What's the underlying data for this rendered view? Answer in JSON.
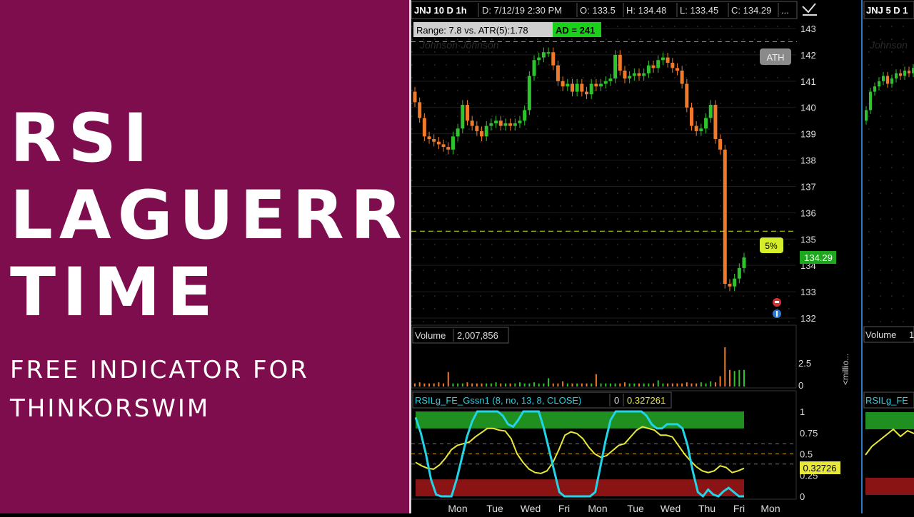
{
  "banner": {
    "title_lines": [
      "RSI",
      "LAGUERRE",
      "TIME"
    ],
    "subtitle_lines": [
      "FREE INDICATOR FOR",
      "THINKORSWIM"
    ]
  },
  "chart_main": {
    "symbol_label": "JNJ 10 D 1h",
    "date_label": "D: 7/12/19 2:30 PM",
    "open_label": "O: 133.5",
    "high_label": "H: 134.48",
    "low_label": "L: 133.45",
    "close_label": "C: 134.29",
    "more_label": "...",
    "range_label": "Range: 7.8 vs. ATR(5):1.78",
    "ad_label": "AD = 241",
    "ath_label": "ATH",
    "pct_label": "5%",
    "last_price_label": "134.29",
    "logo_text": "Johnson·Johnson"
  },
  "chart_side": {
    "symbol_label": "JNJ 5 D 1",
    "logo_text": "Johnson",
    "volume_label": "Volume",
    "volume_value": "1",
    "rsi_label": "RSILg_FE"
  },
  "volume": {
    "label": "Volume",
    "value": "2,007,856",
    "axis_tick": "2.5",
    "axis_zero": "0",
    "unit_label": "<millio..."
  },
  "rsi": {
    "label": "RSILg_FE_Gssn1 (8, no, 13, 8, CLOSE)",
    "flag": "0",
    "value": "0.327261",
    "last_value_label": "0.32726"
  },
  "x_axis": {
    "labels": [
      "Mon",
      "Tue",
      "Wed",
      "Fri",
      "Mon",
      "Tue",
      "Wed",
      "Thu",
      "Fri",
      "Mon"
    ]
  },
  "colors": {
    "banner_bg": "#7e0d4e",
    "up_candle": "#2ec42e",
    "down_candle": "#f07a2a",
    "rsi_line": "#22d4e8",
    "signal_line": "#e8e83a",
    "overbought_zone": "#1f8f1f",
    "oversold_zone": "#8a1414"
  },
  "chart_data": [
    {
      "type": "candlestick",
      "title": "JNJ 10 D 1h",
      "ylim": [
        132,
        143
      ],
      "y_ticks": [
        132,
        133,
        134,
        135,
        136,
        137,
        138,
        139,
        140,
        141,
        142,
        143
      ],
      "grid": true,
      "closes": [
        140.2,
        139.6,
        138.9,
        138.8,
        138.7,
        138.6,
        138.5,
        138.4,
        138.9,
        139.2,
        140.1,
        139.5,
        139.3,
        139.1,
        138.9,
        139.3,
        139.4,
        139.5,
        139.3,
        139.4,
        139.3,
        139.4,
        139.5,
        139.9,
        141.2,
        141.8,
        141.9,
        142.1,
        142.1,
        141.6,
        141.0,
        140.8,
        140.9,
        140.6,
        140.9,
        140.6,
        140.5,
        140.9,
        140.8,
        140.9,
        141.0,
        141.1,
        142.0,
        141.4,
        141.1,
        141.2,
        141.3,
        141.2,
        141.3,
        141.6,
        141.5,
        141.8,
        141.9,
        141.7,
        141.5,
        141.4,
        140.9,
        140.0,
        139.3,
        139.1,
        139.2,
        139.6,
        140.1,
        138.8,
        138.4,
        133.3,
        133.2,
        133.5,
        133.9,
        134.3
      ],
      "ath": 142.5,
      "level_5pct": 135.3,
      "last_price": 134.29
    },
    {
      "type": "bar",
      "title": "Volume",
      "unit": "millions",
      "ylim": [
        0,
        4
      ],
      "y_ticks": [
        0,
        2.5
      ],
      "values": [
        0.3,
        0.4,
        0.3,
        0.3,
        0.3,
        0.4,
        0.3,
        1.4,
        0.3,
        0.3,
        0.3,
        0.4,
        0.3,
        0.3,
        0.3,
        0.3,
        0.3,
        0.4,
        0.3,
        0.3,
        0.3,
        0.3,
        0.4,
        0.3,
        0.3,
        0.4,
        0.3,
        0.3,
        0.8,
        0.3,
        0.3,
        0.5,
        0.3,
        0.3,
        0.3,
        0.3,
        0.3,
        0.3,
        1.2,
        0.3,
        0.3,
        0.3,
        0.3,
        0.3,
        0.4,
        0.3,
        0.3,
        0.3,
        0.3,
        0.3,
        0.3,
        0.6,
        0.3,
        0.3,
        0.3,
        0.3,
        0.3,
        0.4,
        0.3,
        0.3,
        0.4,
        0.3,
        0.5,
        0.4,
        1.0,
        3.8,
        1.6,
        1.5,
        1.6,
        1.6
      ]
    },
    {
      "type": "line",
      "title": "RSILg_FE_Gssn1 (8, no, 13, 8, CLOSE)",
      "ylim": [
        0,
        1
      ],
      "y_ticks": [
        0,
        0.25,
        0.5,
        0.75,
        1
      ],
      "overbought": 0.8,
      "oversold": 0.2,
      "series": [
        {
          "name": "RSI",
          "values": [
            0.93,
            0.75,
            0.5,
            0.2,
            0.02,
            0.0,
            0.0,
            0.0,
            0.2,
            0.45,
            0.7,
            0.88,
            1.0,
            1.0,
            1.0,
            1.0,
            1.0,
            0.95,
            0.85,
            0.82,
            0.9,
            1.0,
            1.0,
            1.0,
            1.0,
            0.8,
            0.55,
            0.3,
            0.05,
            0.0,
            0.0,
            0.0,
            0.0,
            0.0,
            0.0,
            0.05,
            0.35,
            0.65,
            0.9,
            1.0,
            1.0,
            1.0,
            1.0,
            1.0,
            1.0,
            0.95,
            0.85,
            0.8,
            0.8,
            0.85,
            0.85,
            0.85,
            0.8,
            0.6,
            0.3,
            0.05,
            0.0,
            0.08,
            0.02,
            0.0,
            0.06,
            0.1,
            0.05,
            0.0,
            0.0
          ]
        },
        {
          "name": "Signal",
          "values": [
            0.4,
            0.36,
            0.33,
            0.32,
            0.37,
            0.45,
            0.55,
            0.6,
            0.62,
            0.64,
            0.7,
            0.75,
            0.8,
            0.8,
            0.78,
            0.77,
            0.68,
            0.5,
            0.4,
            0.32,
            0.28,
            0.27,
            0.3,
            0.4,
            0.55,
            0.72,
            0.76,
            0.74,
            0.68,
            0.58,
            0.5,
            0.46,
            0.48,
            0.54,
            0.6,
            0.62,
            0.7,
            0.78,
            0.82,
            0.8,
            0.78,
            0.72,
            0.72,
            0.7,
            0.6,
            0.5,
            0.42,
            0.35,
            0.3,
            0.28,
            0.3,
            0.36,
            0.34,
            0.28,
            0.3,
            0.33
          ]
        }
      ],
      "last_value": 0.327261
    }
  ]
}
